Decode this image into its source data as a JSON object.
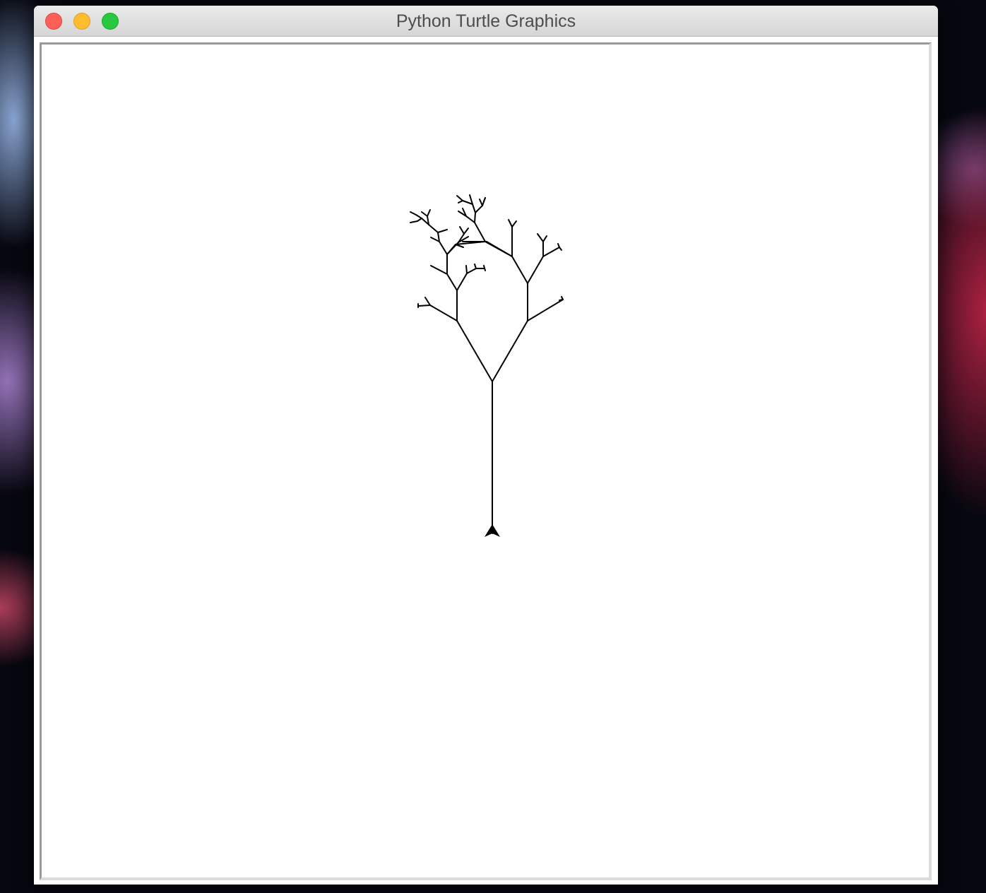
{
  "window": {
    "title": "Python Turtle Graphics",
    "controls": {
      "close": "close-button",
      "minimize": "minimize-button",
      "zoom": "zoom-button"
    }
  },
  "canvas": {
    "background": "#ffffff",
    "pen_color": "#000000",
    "turtle_shape": "classic-arrow",
    "turtle_heading": "up",
    "drawing": "fractal-tree"
  }
}
